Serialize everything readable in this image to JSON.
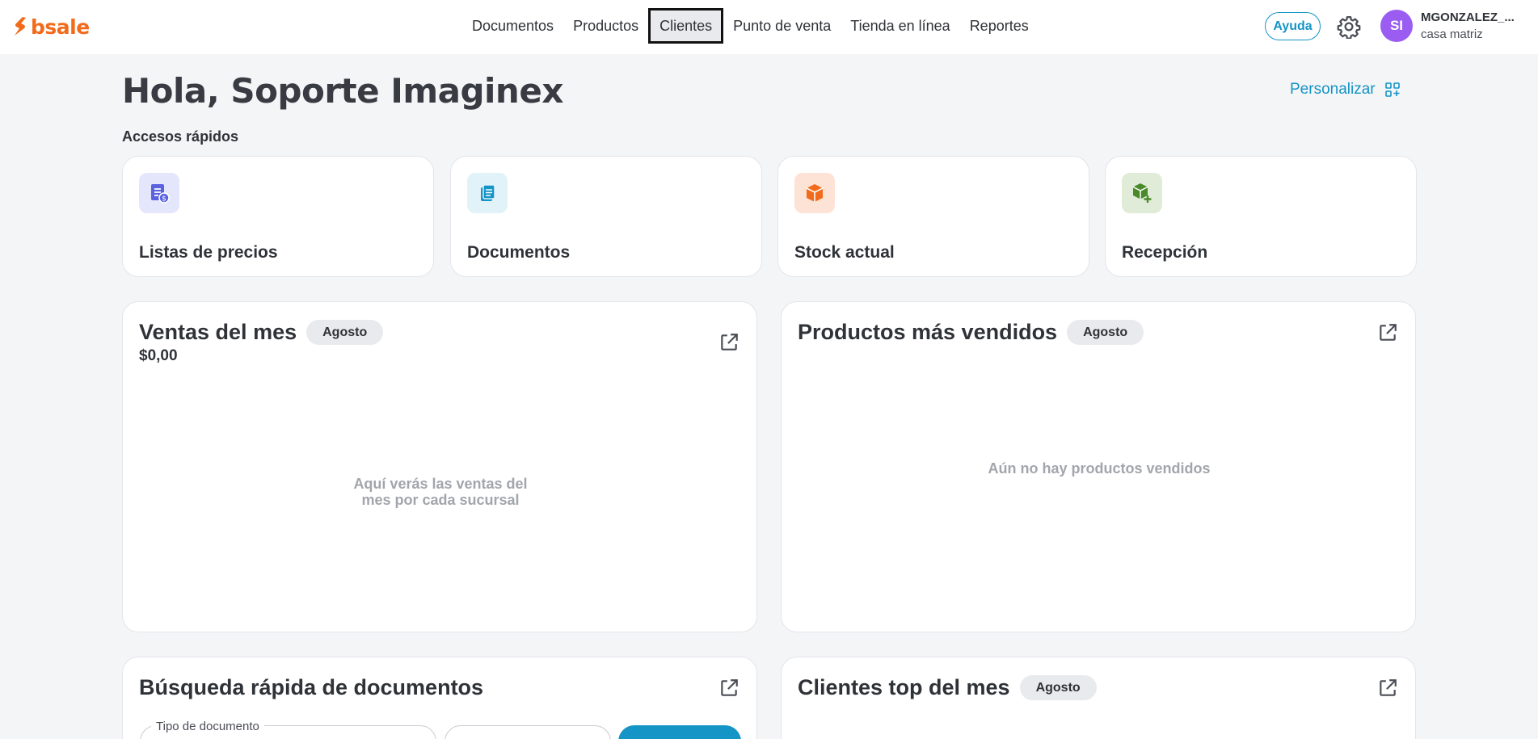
{
  "brand": {
    "name": "bsale",
    "color": "#f26a1b"
  },
  "nav": {
    "items": [
      {
        "label": "Documentos"
      },
      {
        "label": "Productos"
      },
      {
        "label": "Clientes",
        "active": true
      },
      {
        "label": "Punto de venta"
      },
      {
        "label": "Tienda en línea"
      },
      {
        "label": "Reportes"
      }
    ]
  },
  "header": {
    "help_label": "Ayuda",
    "settings_icon": "gear-icon",
    "avatar_initials": "SI",
    "avatar_color": "#9b5cf2",
    "user_name": "MGONZALEZ_...",
    "user_branch": "casa matriz"
  },
  "greeting": "Hola, Soporte Imaginex",
  "customize_label": "Personalizar",
  "quick_access": {
    "title": "Accesos rápidos",
    "items": [
      {
        "label": "Listas de precios",
        "icon": "price-list-icon",
        "icon_color": "#5b62e0",
        "icon_bg": "#e4e6fb"
      },
      {
        "label": "Documentos",
        "icon": "document-icon",
        "icon_color": "#1594c6",
        "icon_bg": "#e1f2f9"
      },
      {
        "label": "Stock actual",
        "icon": "box-icon",
        "icon_color": "#f26a1b",
        "icon_bg": "#fde3d6"
      },
      {
        "label": "Recepción",
        "icon": "box-add-icon",
        "icon_color": "#4a8a2a",
        "icon_bg": "#e0ecd8"
      }
    ]
  },
  "panels": {
    "sales": {
      "title": "Ventas del mes",
      "badge": "Agosto",
      "amount": "$0,00",
      "empty": "Aquí verás las ventas del mes por cada sucursal"
    },
    "top_products": {
      "title": "Productos más vendidos",
      "badge": "Agosto",
      "empty": "Aún no hay productos vendidos"
    },
    "doc_search": {
      "title": "Búsqueda rápida de documentos",
      "field_label": "Tipo de documento"
    },
    "top_clients": {
      "title": "Clientes top del mes",
      "badge": "Agosto"
    }
  },
  "accent_color": "#1594c6"
}
